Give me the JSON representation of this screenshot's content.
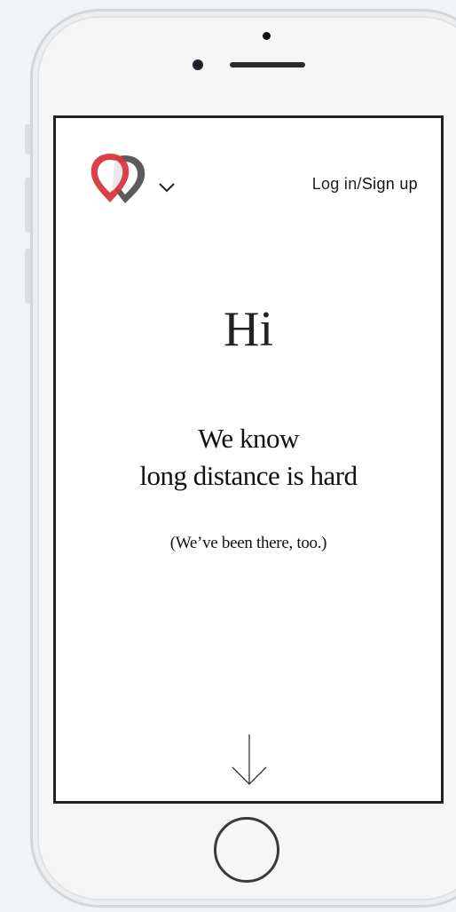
{
  "header": {
    "logo_icon": "heart-location-pins-logo",
    "menu_icon": "chevron-down-icon",
    "login_label": "Log in",
    "separator": "/",
    "signup_label": "Sign up"
  },
  "hero": {
    "greeting": "Hi",
    "headline_line1": "We know",
    "headline_line2": "long distance is hard",
    "subline": "(We’ve been there, too.)"
  },
  "scroll": {
    "icon": "arrow-down-icon"
  },
  "colors": {
    "logo_red": "#d9363e",
    "logo_gray": "#5a5a5a",
    "text": "#111111",
    "phone_frame": "#f6f6f6",
    "background": "#f1f3f4"
  }
}
